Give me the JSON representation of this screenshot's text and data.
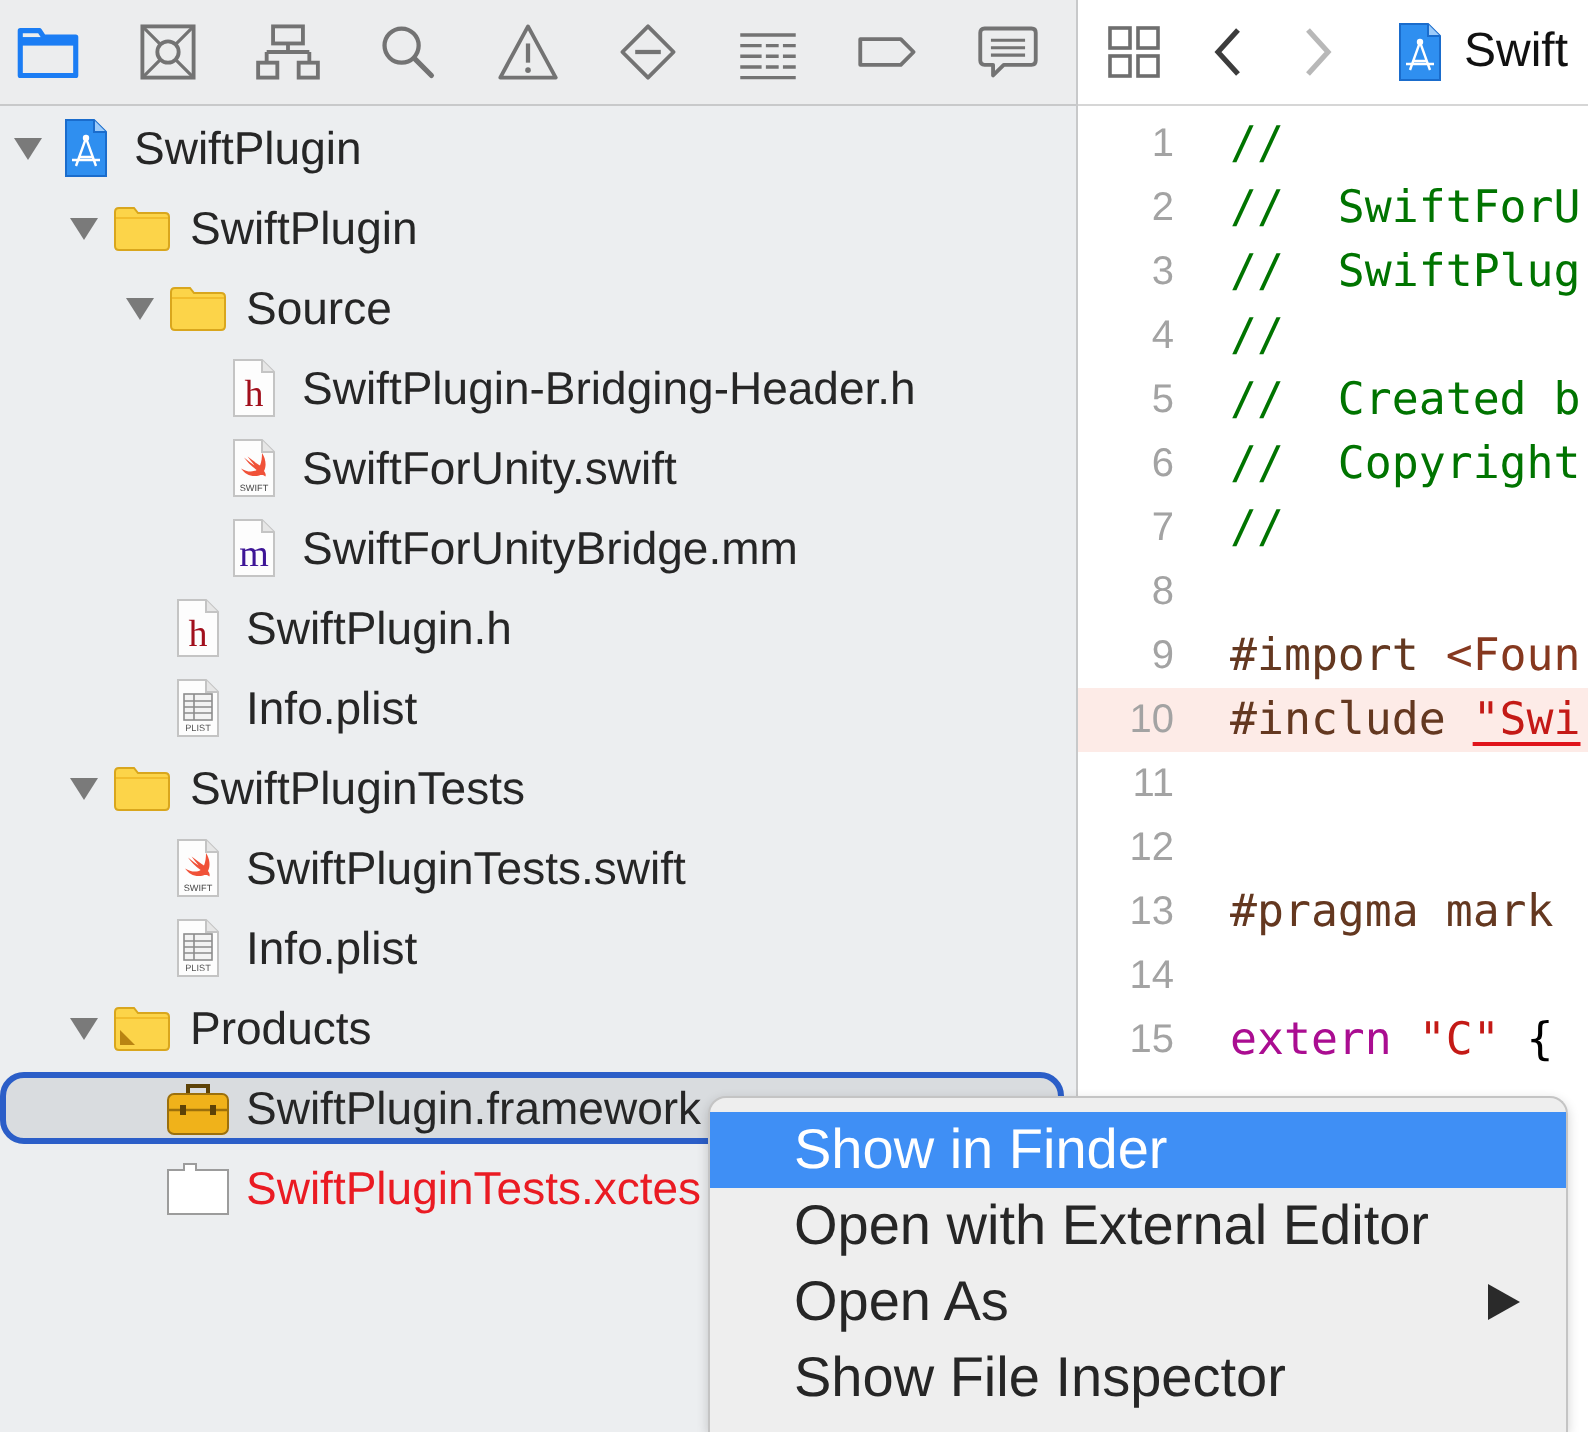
{
  "navigator_tabs": [
    {
      "kind": "project",
      "selected": true
    },
    {
      "kind": "source-control",
      "selected": false
    },
    {
      "kind": "symbol",
      "selected": false
    },
    {
      "kind": "find",
      "selected": false
    },
    {
      "kind": "issue",
      "selected": false
    },
    {
      "kind": "test",
      "selected": false
    },
    {
      "kind": "debug",
      "selected": false
    },
    {
      "kind": "breakpoint",
      "selected": false
    },
    {
      "kind": "report",
      "selected": false
    }
  ],
  "jump_bar": {
    "back_disabled": false,
    "forward_disabled": true,
    "path": "Swift"
  },
  "tree": [
    {
      "name": "SwiftPlugin",
      "kind": "project",
      "expanded": true,
      "selected": false,
      "missing": false,
      "children": [
        {
          "name": "SwiftPlugin",
          "kind": "folder",
          "expanded": true,
          "selected": false,
          "missing": false,
          "children": [
            {
              "name": "Source",
              "kind": "folder",
              "expanded": true,
              "selected": false,
              "missing": false,
              "children": [
                {
                  "name": "SwiftPlugin-Bridging-Header.h",
                  "kind": "header",
                  "icon_text": "h",
                  "selected": false,
                  "missing": false
                },
                {
                  "name": "SwiftForUnity.swift",
                  "kind": "swift",
                  "icon_text": "SWIFT",
                  "selected": false,
                  "missing": false
                },
                {
                  "name": "SwiftForUnityBridge.mm",
                  "kind": "objc",
                  "icon_text": "m",
                  "selected": false,
                  "missing": false
                }
              ]
            },
            {
              "name": "SwiftPlugin.h",
              "kind": "header",
              "icon_text": "h",
              "selected": false,
              "missing": false
            },
            {
              "name": "Info.plist",
              "kind": "plist",
              "icon_text": "PLIST",
              "selected": false,
              "missing": false
            }
          ]
        },
        {
          "name": "SwiftPluginTests",
          "kind": "folder",
          "expanded": true,
          "selected": false,
          "missing": false,
          "children": [
            {
              "name": "SwiftPluginTests.swift",
              "kind": "swift",
              "icon_text": "SWIFT",
              "selected": false,
              "missing": false
            },
            {
              "name": "Info.plist",
              "kind": "plist",
              "icon_text": "PLIST",
              "selected": false,
              "missing": false
            }
          ]
        },
        {
          "name": "Products",
          "kind": "products-folder",
          "expanded": true,
          "selected": false,
          "missing": false,
          "children": [
            {
              "name": "SwiftPlugin.framework",
              "kind": "framework",
              "selected": true,
              "missing": false
            },
            {
              "name": "SwiftPluginTests.xctes",
              "kind": "xctest",
              "selected": false,
              "missing": true
            }
          ]
        }
      ]
    }
  ],
  "code_lines": [
    {
      "number": "1",
      "error": false,
      "segments": [
        {
          "kind": "comment",
          "text": "//"
        }
      ]
    },
    {
      "number": "2",
      "error": false,
      "segments": [
        {
          "kind": "comment",
          "text": "//  SwiftForU"
        }
      ]
    },
    {
      "number": "3",
      "error": false,
      "segments": [
        {
          "kind": "comment",
          "text": "//  SwiftPlug"
        }
      ]
    },
    {
      "number": "4",
      "error": false,
      "segments": [
        {
          "kind": "comment",
          "text": "//"
        }
      ]
    },
    {
      "number": "5",
      "error": false,
      "segments": [
        {
          "kind": "comment",
          "text": "//  Created b"
        }
      ]
    },
    {
      "number": "6",
      "error": false,
      "segments": [
        {
          "kind": "comment",
          "text": "//  Copyright"
        }
      ]
    },
    {
      "number": "7",
      "error": false,
      "segments": [
        {
          "kind": "comment",
          "text": "//"
        }
      ]
    },
    {
      "number": "8",
      "error": false
    },
    {
      "number": "9",
      "error": false,
      "segments": [
        {
          "kind": "directive",
          "text": "#import "
        },
        {
          "kind": "header",
          "text": "<Foun"
        }
      ]
    },
    {
      "number": "10",
      "error": true,
      "segments": [
        {
          "kind": "directive",
          "text": "#include "
        },
        {
          "kind": "error-string",
          "text": "\"Swi"
        }
      ]
    },
    {
      "number": "11",
      "error": false
    },
    {
      "number": "12",
      "error": false
    },
    {
      "number": "13",
      "error": false,
      "segments": [
        {
          "kind": "directive",
          "text": "#pragma mark"
        }
      ]
    },
    {
      "number": "14",
      "error": false
    },
    {
      "number": "15",
      "error": false,
      "segments": [
        {
          "kind": "keyword",
          "text": "extern"
        },
        {
          "kind": "string",
          "text": " \"C\""
        },
        {
          "kind": "plain",
          "text": " {"
        }
      ]
    }
  ],
  "context_menu": {
    "items": [
      {
        "label": "Show in Finder",
        "selected": true,
        "submenu": false
      },
      {
        "label": "Open with External Editor",
        "selected": false,
        "submenu": false
      },
      {
        "label": "Open As",
        "selected": false,
        "submenu": true
      },
      {
        "label": "Show File Inspector",
        "selected": false,
        "submenu": false
      }
    ]
  }
}
